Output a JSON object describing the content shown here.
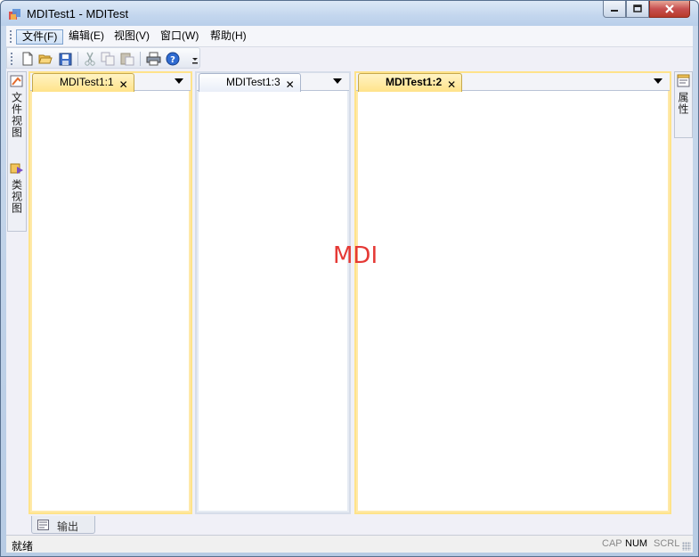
{
  "window": {
    "title": "MDITest1 - MDITest"
  },
  "menu": {
    "items": [
      {
        "label": "文件(F)",
        "active": true
      },
      {
        "label": "编辑(E)",
        "active": false
      },
      {
        "label": "视图(V)",
        "active": false
      },
      {
        "label": "窗口(W)",
        "active": false
      },
      {
        "label": "帮助(H)",
        "active": false
      }
    ]
  },
  "toolbar": {
    "buttons": [
      "new-icon",
      "open-folder-icon",
      "save-icon",
      "cut-icon",
      "copy-icon",
      "paste-icon",
      "print-icon",
      "help-icon"
    ]
  },
  "left_panel": {
    "tabs": [
      {
        "label": "文件视图",
        "icon": "file-view-icon"
      },
      {
        "label": "类视图",
        "icon": "class-view-icon"
      }
    ]
  },
  "right_panel": {
    "tabs": [
      {
        "label": "属性",
        "icon": "properties-icon"
      }
    ]
  },
  "documents": [
    {
      "tab": "MDITest1:1",
      "style": "yellow",
      "bold": false
    },
    {
      "tab": "MDITest1:3",
      "style": "blue",
      "bold": false
    },
    {
      "tab": "MDITest1:2",
      "style": "yellow",
      "bold": true
    }
  ],
  "watermark": "MDI",
  "output_tab": {
    "label": "输出"
  },
  "status": {
    "text": "就绪",
    "indicators": [
      {
        "label": "CAP",
        "on": false
      },
      {
        "label": "NUM",
        "on": true
      },
      {
        "label": "SCRL",
        "on": false
      }
    ]
  },
  "colors": {
    "accent_yellow": "#ffe38a",
    "watermark": "#e53935",
    "close_button": "#c75050"
  }
}
